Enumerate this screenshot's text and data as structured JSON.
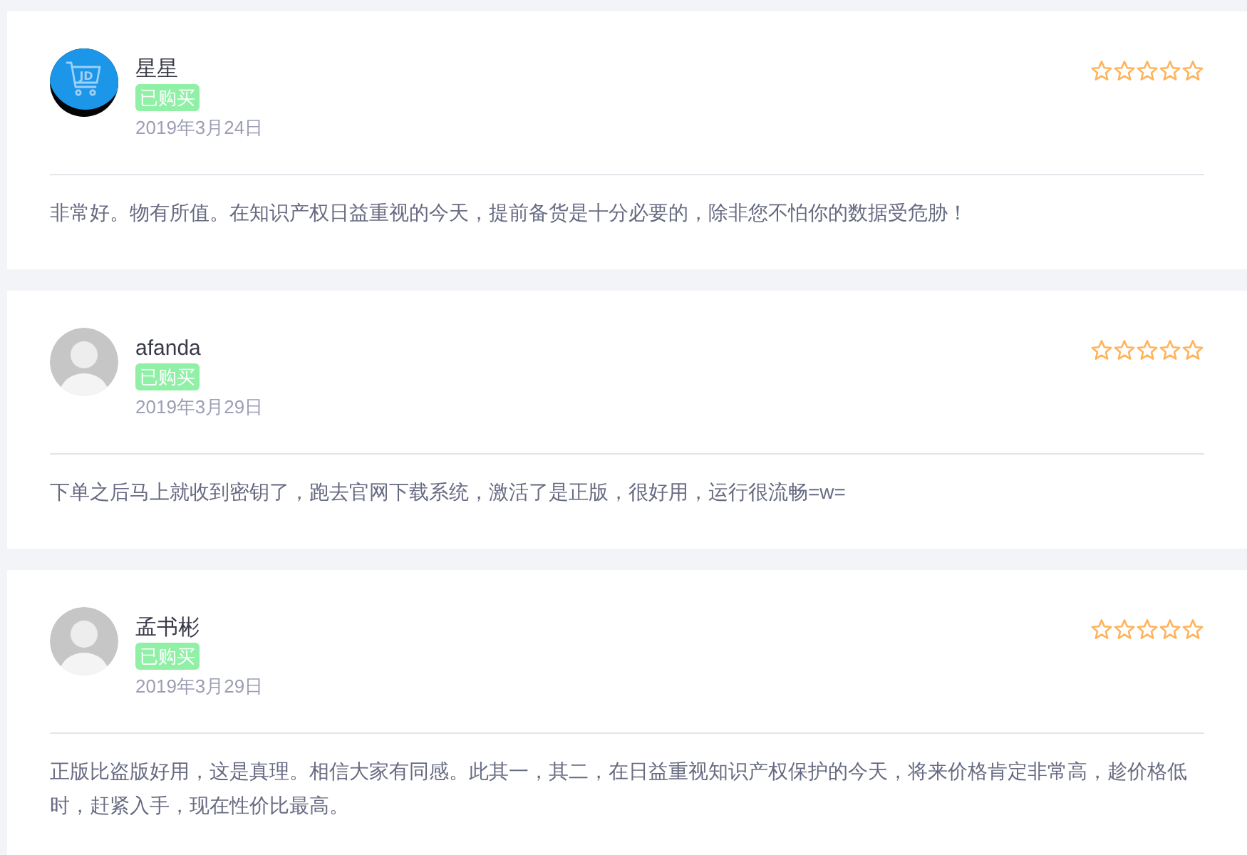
{
  "reviews": [
    {
      "avatar": {
        "kind": "logo",
        "logo_text": "JD"
      },
      "name": "星星",
      "badge": "已购买",
      "date": "2019年3月24日",
      "stars": 0,
      "comment": "非常好。物有所值。在知识产权日益重视的今天，提前备货是十分必要的，除非您不怕你的数据受危胁！"
    },
    {
      "avatar": {
        "kind": "default"
      },
      "name": "afanda",
      "badge": "已购买",
      "date": "2019年3月29日",
      "stars": 0,
      "comment": "下单之后马上就收到密钥了，跑去官网下载系统，激活了是正版，很好用，运行很流畅=w="
    },
    {
      "avatar": {
        "kind": "default"
      },
      "name": "孟书彬",
      "badge": "已购买",
      "date": "2019年3月29日",
      "stars": 0,
      "comment": "正版比盗版好用，这是真理。相信大家有同感。此其一，其二，在日益重视知识产权保护的今天，将来价格肯定非常高，趁价格低时，赶紧入手，现在性价比最高。"
    }
  ]
}
